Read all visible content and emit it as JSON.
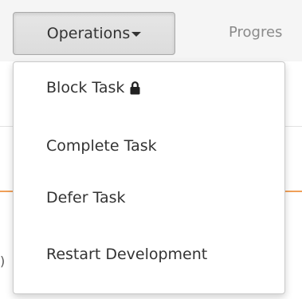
{
  "toolbar": {
    "operations_label": "Operations",
    "progress_tab_label": "Progres"
  },
  "background": {
    "left_edge_glyph": ")"
  },
  "menu": {
    "items": [
      {
        "label": "Block Task",
        "icon": "lock-icon"
      },
      {
        "label": "Complete Task"
      },
      {
        "label": "Defer Task"
      },
      {
        "label": "Restart Development"
      }
    ]
  },
  "colors": {
    "accent_line": "#f0a058",
    "button_bg": "#e0e0e0",
    "text": "#333333",
    "muted_text": "#8a8a8a"
  }
}
